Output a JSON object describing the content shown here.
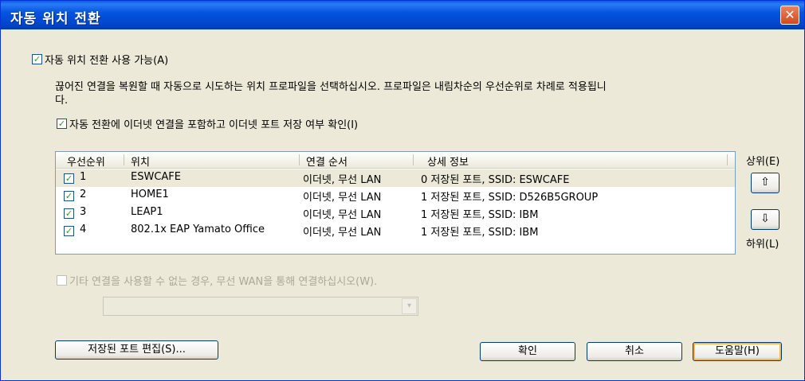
{
  "window": {
    "title": "자동 위치 전환",
    "close": "✕"
  },
  "enable_checkbox": {
    "label": "자동 위치 전환 사용 가능(A)",
    "checked": true
  },
  "description": {
    "line1": "끊어진 연결을 복원할 때 자동으로 시도하는 위치 프로파일을 선택하십시오. 프로파일은 내림차순의 우선순위로 차례로 적용됩니",
    "line2": "다."
  },
  "ethernet_checkbox": {
    "label": "자동 전환에 이더넷 연결을 포함하고 이더넷 포트 저장 여부 확인(I)",
    "checked": true
  },
  "table": {
    "headers": [
      "우선순위",
      "위치",
      "연결 순서",
      "상세 정보"
    ],
    "rows": [
      {
        "priority": "1",
        "location": "ESWCAFE",
        "order": "이더넷, 무선 LAN",
        "detail": "0 저장된 포트,  SSID: ESWCAFE"
      },
      {
        "priority": "2",
        "location": "HOME1",
        "order": "이더넷, 무선 LAN",
        "detail": "1 저장된 포트,  SSID: D526B5GROUP"
      },
      {
        "priority": "3",
        "location": "LEAP1",
        "order": "이더넷, 무선 LAN",
        "detail": "1 저장된 포트,  SSID: IBM"
      },
      {
        "priority": "4",
        "location": "802.1x EAP Yamato Office",
        "order": "이더넷, 무선 LAN",
        "detail": "1 저장된 포트,  SSID: IBM"
      }
    ]
  },
  "up": {
    "label": "상위(E)",
    "icon": "⇧"
  },
  "down": {
    "label": "하위(L)",
    "icon": "⇩"
  },
  "wan_checkbox": {
    "label": "기타 연결을 사용할 수 없는 경우, 무선 WAN을 통해 연결하십시오(W).",
    "checked": false,
    "disabled": true
  },
  "wan_combo": {
    "value": "",
    "arrow": "▾"
  },
  "buttons": {
    "edit_ports": "저장된 포트 편집(S)...",
    "ok": "확인",
    "cancel": "취소",
    "help": "도움말(H)"
  }
}
